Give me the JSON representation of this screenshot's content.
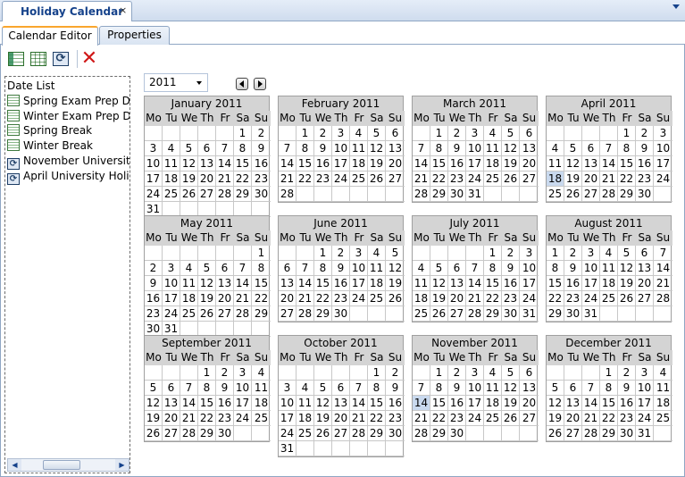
{
  "doc_tab": {
    "label": "Holiday Calendar",
    "close": "×"
  },
  "sub_tabs": [
    {
      "label": "Calendar Editor",
      "active": true
    },
    {
      "label": "Properties",
      "active": false
    }
  ],
  "toolbar": {
    "buttons": [
      "grid-add-icon",
      "grid-table-icon",
      "refresh-grid-icon",
      "delete-icon"
    ],
    "delete_glyph": "✕"
  },
  "date_list": {
    "header": "Date List",
    "items": [
      {
        "label": "Spring Exam Prep Day",
        "icon": "grid-date-icon"
      },
      {
        "label": "Winter Exam Prep Day",
        "icon": "grid-date-icon"
      },
      {
        "label": "Spring Break",
        "icon": "grid-date-icon"
      },
      {
        "label": "Winter Break",
        "icon": "grid-date-icon"
      },
      {
        "label": "November University H",
        "icon": "recurring-date-icon"
      },
      {
        "label": "April University Holida",
        "icon": "recurring-date-icon"
      }
    ],
    "scroll_left": "◀",
    "scroll_right": "▶"
  },
  "year_selector": {
    "value": "2011"
  },
  "weekdays": [
    "Mo",
    "Tu",
    "We",
    "Th",
    "Fr",
    "Sa",
    "Su"
  ],
  "months": [
    {
      "title": "January 2011",
      "weeks": [
        [
          "",
          "",
          "",
          "",
          "",
          "1",
          "2"
        ],
        [
          "3",
          "4",
          "5",
          "6",
          "7",
          "8",
          "9"
        ],
        [
          "10",
          "11",
          "12",
          "13",
          "14",
          "15",
          "16"
        ],
        [
          "17",
          "18",
          "19",
          "20",
          "21",
          "22",
          "23"
        ],
        [
          "24",
          "25",
          "26",
          "27",
          "28",
          "29",
          "30"
        ],
        [
          "31",
          "",
          "",
          "",
          "",
          "",
          ""
        ]
      ]
    },
    {
      "title": "February 2011",
      "weeks": [
        [
          "",
          "1",
          "2",
          "3",
          "4",
          "5",
          "6"
        ],
        [
          "7",
          "8",
          "9",
          "10",
          "11",
          "12",
          "13"
        ],
        [
          "14",
          "15",
          "16",
          "17",
          "18",
          "19",
          "20"
        ],
        [
          "21",
          "22",
          "23",
          "24",
          "25",
          "26",
          "27"
        ],
        [
          "28",
          "",
          "",
          "",
          "",
          "",
          ""
        ]
      ]
    },
    {
      "title": "March 2011",
      "weeks": [
        [
          "",
          "1",
          "2",
          "3",
          "4",
          "5",
          "6"
        ],
        [
          "7",
          "8",
          "9",
          "10",
          "11",
          "12",
          "13"
        ],
        [
          "14",
          "15",
          "16",
          "17",
          "18",
          "19",
          "20"
        ],
        [
          "21",
          "22",
          "23",
          "24",
          "25",
          "26",
          "27"
        ],
        [
          "28",
          "29",
          "30",
          "31",
          "",
          "",
          ""
        ]
      ]
    },
    {
      "title": "April 2011",
      "weeks": [
        [
          "",
          "",
          "",
          "",
          "1",
          "2",
          "3"
        ],
        [
          "4",
          "5",
          "6",
          "7",
          "8",
          "9",
          "10"
        ],
        [
          "11",
          "12",
          "13",
          "14",
          "15",
          "16",
          "17"
        ],
        [
          "18",
          "19",
          "20",
          "21",
          "22",
          "23",
          "24"
        ],
        [
          "25",
          "26",
          "27",
          "28",
          "29",
          "30",
          ""
        ]
      ],
      "selected": "18"
    },
    {
      "title": "May 2011",
      "weeks": [
        [
          "",
          "",
          "",
          "",
          "",
          "",
          "1"
        ],
        [
          "2",
          "3",
          "4",
          "5",
          "6",
          "7",
          "8"
        ],
        [
          "9",
          "10",
          "11",
          "12",
          "13",
          "14",
          "15"
        ],
        [
          "16",
          "17",
          "18",
          "19",
          "20",
          "21",
          "22"
        ],
        [
          "23",
          "24",
          "25",
          "26",
          "27",
          "28",
          "29"
        ],
        [
          "30",
          "31",
          "",
          "",
          "",
          "",
          ""
        ]
      ]
    },
    {
      "title": "June 2011",
      "weeks": [
        [
          "",
          "",
          "1",
          "2",
          "3",
          "4",
          "5"
        ],
        [
          "6",
          "7",
          "8",
          "9",
          "10",
          "11",
          "12"
        ],
        [
          "13",
          "14",
          "15",
          "16",
          "17",
          "18",
          "19"
        ],
        [
          "20",
          "21",
          "22",
          "23",
          "24",
          "25",
          "26"
        ],
        [
          "27",
          "28",
          "29",
          "30",
          "",
          "",
          ""
        ]
      ]
    },
    {
      "title": "July 2011",
      "weeks": [
        [
          "",
          "",
          "",
          "",
          "1",
          "2",
          "3"
        ],
        [
          "4",
          "5",
          "6",
          "7",
          "8",
          "9",
          "10"
        ],
        [
          "11",
          "12",
          "13",
          "14",
          "15",
          "16",
          "17"
        ],
        [
          "18",
          "19",
          "20",
          "21",
          "22",
          "23",
          "24"
        ],
        [
          "25",
          "26",
          "27",
          "28",
          "29",
          "30",
          "31"
        ]
      ]
    },
    {
      "title": "August 2011",
      "weeks": [
        [
          "1",
          "2",
          "3",
          "4",
          "5",
          "6",
          "7"
        ],
        [
          "8",
          "9",
          "10",
          "11",
          "12",
          "13",
          "14"
        ],
        [
          "15",
          "16",
          "17",
          "18",
          "19",
          "20",
          "21"
        ],
        [
          "22",
          "23",
          "24",
          "25",
          "26",
          "27",
          "28"
        ],
        [
          "29",
          "30",
          "31",
          "",
          "",
          "",
          ""
        ]
      ]
    },
    {
      "title": "September 2011",
      "weeks": [
        [
          "",
          "",
          "",
          "1",
          "2",
          "3",
          "4"
        ],
        [
          "5",
          "6",
          "7",
          "8",
          "9",
          "10",
          "11"
        ],
        [
          "12",
          "13",
          "14",
          "15",
          "16",
          "17",
          "18"
        ],
        [
          "19",
          "20",
          "21",
          "22",
          "23",
          "24",
          "25"
        ],
        [
          "26",
          "27",
          "28",
          "29",
          "30",
          "",
          ""
        ]
      ]
    },
    {
      "title": "October 2011",
      "weeks": [
        [
          "",
          "",
          "",
          "",
          "",
          "1",
          "2"
        ],
        [
          "3",
          "4",
          "5",
          "6",
          "7",
          "8",
          "9"
        ],
        [
          "10",
          "11",
          "12",
          "13",
          "14",
          "15",
          "16"
        ],
        [
          "17",
          "18",
          "19",
          "20",
          "21",
          "22",
          "23"
        ],
        [
          "24",
          "25",
          "26",
          "27",
          "28",
          "29",
          "30"
        ],
        [
          "31",
          "",
          "",
          "",
          "",
          "",
          ""
        ]
      ]
    },
    {
      "title": "November 2011",
      "weeks": [
        [
          "",
          "1",
          "2",
          "3",
          "4",
          "5",
          "6"
        ],
        [
          "7",
          "8",
          "9",
          "10",
          "11",
          "12",
          "13"
        ],
        [
          "14",
          "15",
          "16",
          "17",
          "18",
          "19",
          "20"
        ],
        [
          "21",
          "22",
          "23",
          "24",
          "25",
          "26",
          "27"
        ],
        [
          "28",
          "29",
          "30",
          "",
          "",
          "",
          ""
        ]
      ],
      "selected": "14"
    },
    {
      "title": "December 2011",
      "weeks": [
        [
          "",
          "",
          "",
          "1",
          "2",
          "3",
          "4"
        ],
        [
          "5",
          "6",
          "7",
          "8",
          "9",
          "10",
          "11"
        ],
        [
          "12",
          "13",
          "14",
          "15",
          "16",
          "17",
          "18"
        ],
        [
          "19",
          "20",
          "21",
          "22",
          "23",
          "24",
          "25"
        ],
        [
          "26",
          "27",
          "28",
          "29",
          "30",
          "31",
          ""
        ]
      ]
    }
  ]
}
